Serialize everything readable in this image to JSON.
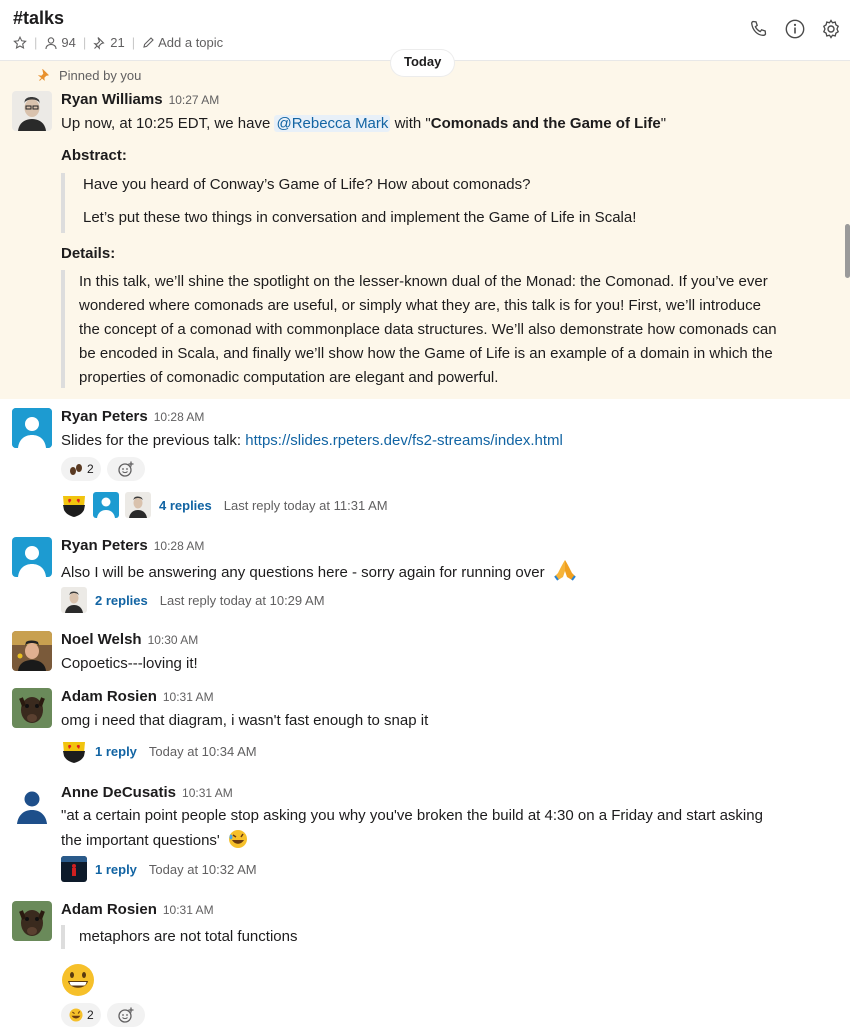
{
  "header": {
    "channel": "#talks",
    "members": "94",
    "pins": "21",
    "topic_label": "Add a topic",
    "icons": [
      "star-icon",
      "person-icon",
      "pin-icon",
      "pencil-icon",
      "phone-icon",
      "info-icon",
      "gear-icon"
    ]
  },
  "today_label": "Today",
  "pinned_label": "Pinned by you",
  "messages": {
    "m1": {
      "name": "Ryan Williams",
      "time": "10:27 AM",
      "text_a": "Up now, at 10:25 EDT, we have ",
      "mention": "@Rebecca Mark",
      "text_b": " with \"",
      "bold": "Comonads and the Game of Life",
      "text_c": "\"",
      "abstract_label": "Abstract:",
      "abstract_1": "Have you heard of Conway’s Game of Life? How about comonads?",
      "abstract_2": "Let’s put these two things in conversation and implement the Game of Life in Scala!",
      "details_label": "Details:",
      "details_1": "In this talk, we’ll shine the spotlight on the lesser-known dual of the Monad: the Comonad. If you’ve ever",
      "details_2": "wondered where comonads are useful, or simply what they are, this talk is for you! First, we’ll introduce",
      "details_3": "the concept of a comonad with commonplace data structures. We’ll also demonstrate how comonads can",
      "details_4": "be encoded in Scala, and finally we’ll show how the Game of Life is an example of a domain in which the",
      "details_5": "properties of comonadic computation are elegant and powerful."
    },
    "m2": {
      "name": "Ryan Peters",
      "time": "10:28 AM",
      "text": "Slides for the previous talk: ",
      "link": "https://slides.rpeters.dev/fs2-streams/index.html",
      "reaction_count": "2",
      "replies": "4 replies",
      "last_reply": "Last reply today at 11:31 AM"
    },
    "m3": {
      "name": "Ryan Peters",
      "time": "10:28 AM",
      "text": "Also I will be answering any questions here - sorry again for running over",
      "replies": "2 replies",
      "last_reply": "Last reply today at 10:29 AM"
    },
    "m4": {
      "name": "Noel Welsh",
      "time": "10:30 AM",
      "text": "Copoetics---loving it!"
    },
    "m5": {
      "name": "Adam Rosien",
      "time": "10:31 AM",
      "text": "omg i need that diagram, i wasn't fast enough to snap it",
      "replies": "1 reply",
      "last_reply": "Today at 10:34 AM"
    },
    "m6": {
      "name": "Anne DeCusatis",
      "time": "10:31 AM",
      "text_1": "\"at a certain point people stop asking you why you've broken the build at 4:30 on a Friday and start asking",
      "text_2": "the important questions'",
      "replies": "1 reply",
      "last_reply": "Today at 10:32 AM"
    },
    "m7": {
      "name": "Adam Rosien",
      "time": "10:31 AM",
      "quote": "metaphors are not total functions",
      "reaction_count": "2"
    }
  },
  "colors": {
    "link": "#1264a3",
    "pinned_bg": "#fdf7ea",
    "mention_bg": "#e8f0f8"
  }
}
